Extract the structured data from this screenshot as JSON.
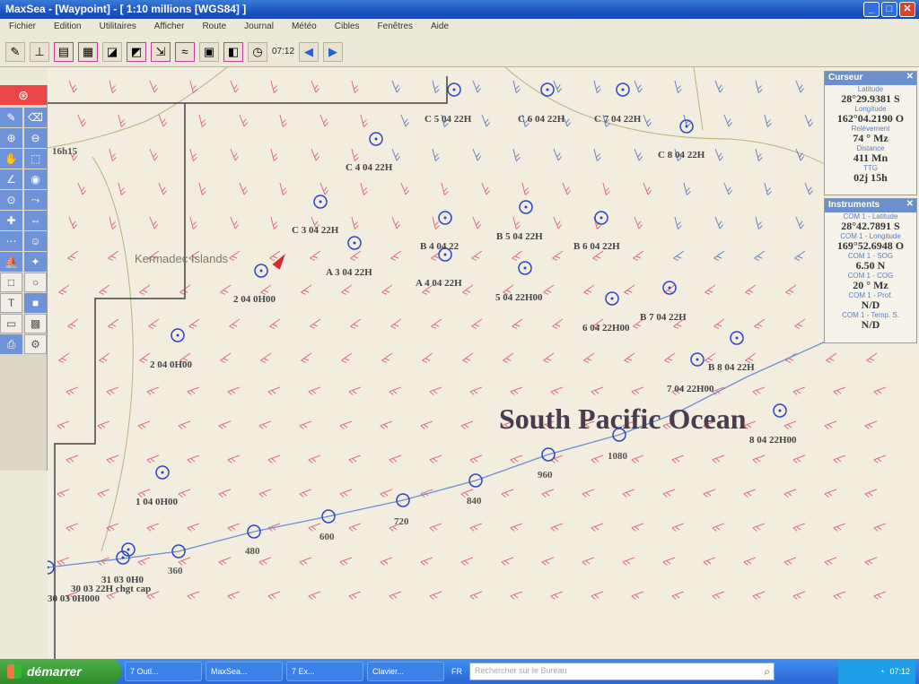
{
  "window": {
    "title": "MaxSea - [Waypoint] - [ 1:10 millions [WGS84] ]"
  },
  "menu": [
    "Fichier",
    "Edition",
    "Utilitaires",
    "Afficher",
    "Route",
    "Journal",
    "Météo",
    "Cibles",
    "Fenêtres",
    "Aide"
  ],
  "toolbar": {
    "time": "07:12"
  },
  "map": {
    "labels": {
      "kermadec": "Kermadec Islands",
      "ocean": "South Pacific Ocean",
      "time_label": "16h15"
    },
    "waypoints": [
      {
        "label": "C 5 04 22H"
      },
      {
        "label": "C 6 04 22H"
      },
      {
        "label": "C 7 04 22H"
      },
      {
        "label": "C 8 04 22H"
      },
      {
        "label": "C 4 04 22H"
      },
      {
        "label": "C 3 04 22H"
      },
      {
        "label": "B 4 04 22"
      },
      {
        "label": "B 5 04 22H"
      },
      {
        "label": "B 6 04 22H"
      },
      {
        "label": "A 3 04 22H"
      },
      {
        "label": "A 4 04 22H"
      },
      {
        "label": "5 04 22H00"
      },
      {
        "label": "2 04 0H00"
      },
      {
        "label": "6 04 22H00"
      },
      {
        "label": "B 7 04 22H"
      },
      {
        "label": "2 04 0H00"
      },
      {
        "label": "B 8 04 22H"
      },
      {
        "label": "7 04 22H00"
      },
      {
        "label": "8 04 22H00"
      },
      {
        "label": "1 04 0H00"
      },
      {
        "label": "31 03 0H0"
      },
      {
        "label": "30 03 22H chgt cap"
      },
      {
        "label": "30 03 0H000"
      }
    ],
    "distance_marks": [
      "360",
      "480",
      "600",
      "720",
      "840",
      "960",
      "1080"
    ]
  },
  "curseur": {
    "title": "Curseur",
    "rows": [
      {
        "label": "Latitude",
        "value": "28°29.9381 S"
      },
      {
        "label": "Longitude",
        "value": "162°04.2190 O"
      },
      {
        "label": "Relèvement",
        "value": "74 ° Mz"
      },
      {
        "label": "Distance",
        "value": "411 Mn"
      },
      {
        "label": "TTG",
        "value": "02j 15h"
      }
    ]
  },
  "instruments": {
    "title": "Instruments",
    "rows": [
      {
        "label": "COM 1 - Latitude",
        "value": "28°42.7891 S"
      },
      {
        "label": "COM 1 - Longitude",
        "value": "169°52.6948 O"
      },
      {
        "label": "COM 1 - SOG",
        "value": "6.50 N"
      },
      {
        "label": "COM 1 - COG",
        "value": "20 ° Mz"
      },
      {
        "label": "COM 1 - Prof.",
        "value": "N/D"
      },
      {
        "label": "COM 1 - Temp. S.",
        "value": "N/D"
      }
    ]
  },
  "taskbar": {
    "start_label": "démarrer",
    "tasks": [
      "7 Outl...",
      "MaxSea...",
      "7 Ex...",
      "Clavier..."
    ],
    "lang": "FR",
    "search_placeholder": "Rechercher sur le Bureau",
    "clock": "07:12"
  },
  "colors": {
    "accent": "#1c53c2",
    "wind_red": "#d2425c",
    "wind_blue": "#3a5fb0",
    "waypoint": "#2a45c8"
  }
}
